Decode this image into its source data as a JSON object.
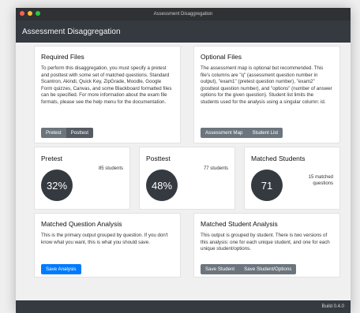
{
  "window": {
    "title": "Assessment Disaggregation"
  },
  "app": {
    "title": "Assessment Disaggregation",
    "build": "Build 0.4.0"
  },
  "required_files": {
    "title": "Required Files",
    "text": "To perform this disaggregation, you must specify a pretest and posttest with some set of matched questions. Standard Scantron, Akindi, Quick Key, ZipGrade, Moodle, Google Form quizzes, Canvas, and some Blackboard formatted files can be specified. For more information about the exam file formats, please see the help menu for the documentation.",
    "pretest_label": "Pretest",
    "posttest_label": "Posttest"
  },
  "optional_files": {
    "title": "Optional Files",
    "text": "The assessment map is optional but recommended. This file's columns are \"q\" (assessment question number in output), \"exam1\" (pretest question number), \"exam2\" (posttest question number), and \"options\" (number of answer options for the given question). Student list limits the students used for the analysis using a singular column: id.",
    "map_label": "Assessment Map",
    "students_label": "Student List"
  },
  "stats": {
    "pretest": {
      "title": "Pretest",
      "note": "85 students",
      "value": "32%"
    },
    "posttest": {
      "title": "Posttest",
      "note": "77 students",
      "value": "48%"
    },
    "matched": {
      "title": "Matched Students",
      "note_line1": "15 matched",
      "note_line2": "questions",
      "value": "71"
    }
  },
  "question_analysis": {
    "title": "Matched Question Analysis",
    "text": "This is the primary output grouped by question. If you don't know what you want, this is what you should save.",
    "save_label": "Save Analysis"
  },
  "student_analysis": {
    "title": "Matched Student Analysis",
    "text": "This output is grouped by student. There is two versions of this analysis: one for each unique student, and one for each unique student/options.",
    "save_student_label": "Save Student",
    "save_options_label": "Save Student/Options"
  },
  "colors": {
    "primary": "#007bff",
    "secondary": "#6c757d",
    "dark": "#343a40"
  }
}
